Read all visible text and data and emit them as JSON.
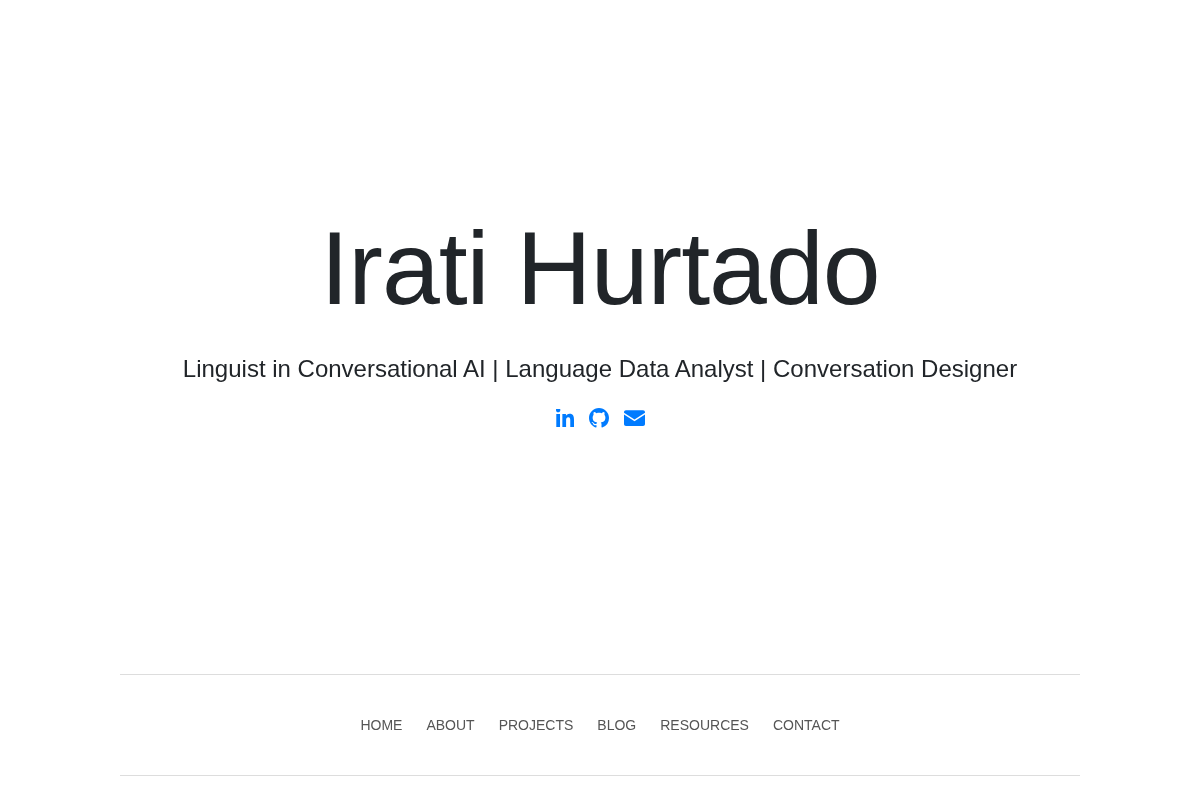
{
  "header": {
    "name": "Irati Hurtado",
    "tagline": "Linguist in Conversational AI | Language Data Analyst | Conversation Designer"
  },
  "nav": {
    "items": [
      {
        "label": "HOME"
      },
      {
        "label": "ABOUT"
      },
      {
        "label": "PROJECTS"
      },
      {
        "label": "BLOG"
      },
      {
        "label": "RESOURCES"
      },
      {
        "label": "CONTACT"
      }
    ]
  }
}
